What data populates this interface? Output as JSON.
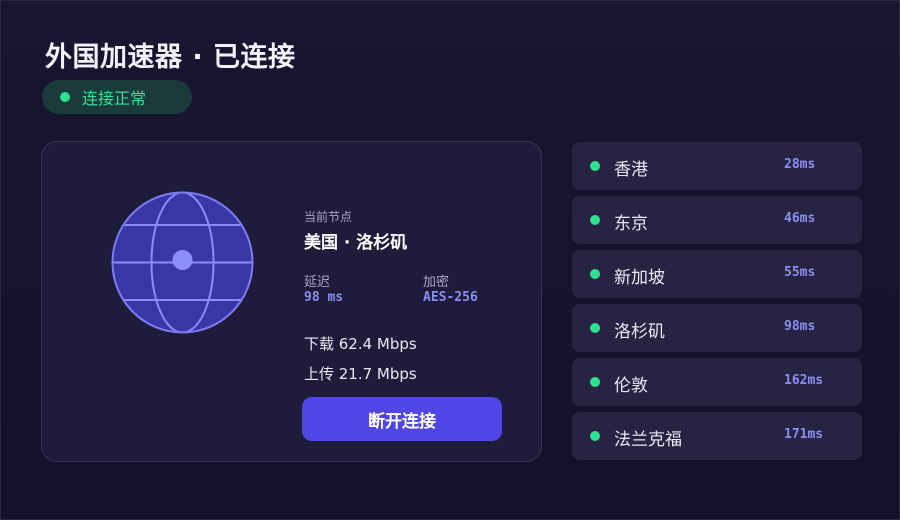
{
  "app": {
    "title": "外国加速器 · 已连接",
    "status_label": "连接正常",
    "status_color": "#2ee08f"
  },
  "connection": {
    "node_caption": "当前节点",
    "node_name": "美国 · 洛杉矶",
    "latency_label": "延迟",
    "latency_value": "98 ms",
    "encryption_label": "加密",
    "encryption_value": "AES-256",
    "download": "下载 62.4 Mbps",
    "upload": "上传 21.7 Mbps",
    "disconnect_label": "断开连接",
    "accent_color": "#4f46e5",
    "globe_icon": "globe-icon"
  },
  "servers": [
    {
      "name": "香港",
      "ping": "28ms"
    },
    {
      "name": "东京",
      "ping": "46ms"
    },
    {
      "name": "新加坡",
      "ping": "55ms"
    },
    {
      "name": "洛杉矶",
      "ping": "98ms"
    },
    {
      "name": "伦敦",
      "ping": "162ms"
    },
    {
      "name": "法兰克福",
      "ping": "171ms"
    }
  ]
}
